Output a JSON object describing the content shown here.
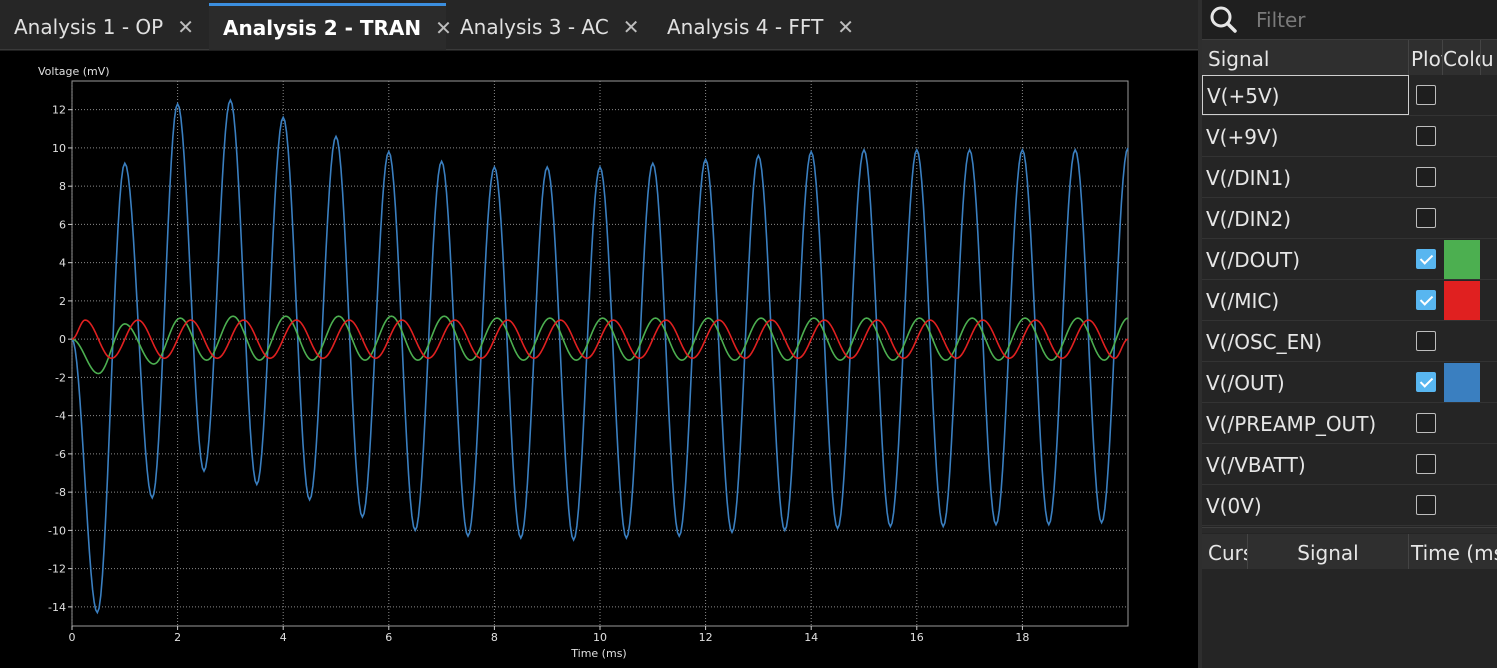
{
  "tabs": [
    {
      "label": "Analysis 1 - OP",
      "active": false
    },
    {
      "label": "Analysis 2 - TRAN",
      "active": true
    },
    {
      "label": "Analysis 3 - AC",
      "active": false
    },
    {
      "label": "Analysis 4 - FFT",
      "active": false
    }
  ],
  "search": {
    "placeholder": "Filter",
    "icon": "search-icon"
  },
  "signals_table": {
    "headers": {
      "signal": "Signal",
      "plot": "Plot",
      "color": "Color",
      "unit": "u"
    },
    "rows": [
      {
        "name": "V(+5V)",
        "plotted": false,
        "color": null,
        "selected": true
      },
      {
        "name": "V(+9V)",
        "plotted": false,
        "color": null
      },
      {
        "name": "V(/DIN1)",
        "plotted": false,
        "color": null
      },
      {
        "name": "V(/DIN2)",
        "plotted": false,
        "color": null
      },
      {
        "name": "V(/DOUT)",
        "plotted": true,
        "color": "#4caf50"
      },
      {
        "name": "V(/MIC)",
        "plotted": true,
        "color": "#e02020"
      },
      {
        "name": "V(/OSC_EN)",
        "plotted": false,
        "color": null
      },
      {
        "name": "V(/OUT)",
        "plotted": true,
        "color": "#3a7fc0"
      },
      {
        "name": "V(/PREAMP_OUT)",
        "plotted": false,
        "color": null
      },
      {
        "name": "V(/VBATT)",
        "plotted": false,
        "color": null
      },
      {
        "name": "V(0V)",
        "plotted": false,
        "color": null
      }
    ]
  },
  "cursors_table": {
    "headers": {
      "cursor": "Cursor",
      "signal": "Signal",
      "time": "Time (ms)"
    }
  },
  "chart_data": {
    "type": "line",
    "ylabel": "Voltage (mV)",
    "xlabel": "Time (ms)",
    "xlim": [
      0,
      20
    ],
    "ylim": [
      -15,
      13.5
    ],
    "xticks": [
      0,
      2,
      4,
      6,
      8,
      10,
      12,
      14,
      16,
      18
    ],
    "yticks": [
      12,
      10,
      8,
      6,
      4,
      2,
      0,
      -2,
      -4,
      -6,
      -8,
      -10,
      -12,
      -14
    ],
    "grid": true,
    "series": [
      {
        "name": "V(/OUT)",
        "color": "#3a7fc0",
        "x": [
          0,
          0.48,
          1.0,
          1.52,
          2.0,
          2.5,
          3.0,
          3.5,
          4.0,
          4.5,
          5.0,
          5.5,
          6.0,
          6.5,
          7.0,
          7.5,
          8.0,
          8.5,
          9.0,
          9.5,
          10.0,
          10.5,
          11.0,
          11.5,
          12.0,
          12.5,
          13.0,
          13.5,
          14.0,
          14.5,
          15.0,
          15.5,
          16.0,
          16.5,
          17.0,
          17.5,
          18.0,
          18.5,
          19.0,
          19.5,
          20.0
        ],
        "y": [
          0,
          -14.3,
          9.2,
          -8.3,
          12.3,
          -6.9,
          12.5,
          -7.6,
          11.6,
          -8.4,
          10.6,
          -9.3,
          9.8,
          -10.0,
          9.3,
          -10.3,
          9.0,
          -10.4,
          9.0,
          -10.5,
          9.0,
          -10.4,
          9.2,
          -10.3,
          9.4,
          -10.1,
          9.6,
          -10.0,
          9.8,
          -9.9,
          9.9,
          -9.8,
          9.9,
          -9.8,
          9.9,
          -9.7,
          9.9,
          -9.7,
          9.9,
          -9.6,
          10.0
        ]
      },
      {
        "name": "V(/DOUT)",
        "color": "#4caf50",
        "x": [
          0,
          0.5,
          1.0,
          1.55,
          2.05,
          2.55,
          3.05,
          3.55,
          4.05,
          4.55,
          5.05,
          5.55,
          6.05,
          6.55,
          7.05,
          7.55,
          8.05,
          8.55,
          9.05,
          9.55,
          10.05,
          10.55,
          11.05,
          11.55,
          12.05,
          12.55,
          13.05,
          13.55,
          14.05,
          14.55,
          15.05,
          15.55,
          16.05,
          16.55,
          17.05,
          17.55,
          18.05,
          18.55,
          19.05,
          19.55,
          20.0
        ],
        "y": [
          0,
          -1.8,
          0.8,
          -1.3,
          1.1,
          -1.1,
          1.2,
          -1.1,
          1.2,
          -1.1,
          1.2,
          -1.1,
          1.2,
          -1.1,
          1.2,
          -1.1,
          1.1,
          -1.1,
          1.1,
          -1.1,
          1.1,
          -1.1,
          1.1,
          -1.1,
          1.1,
          -1.1,
          1.1,
          -1.1,
          1.1,
          -1.1,
          1.1,
          -1.1,
          1.1,
          -1.1,
          1.1,
          -1.1,
          1.1,
          -1.1,
          1.1,
          -1.1,
          1.1
        ]
      },
      {
        "name": "V(/MIC)",
        "color": "#e02020",
        "x": [
          0,
          0.25,
          0.75,
          1.25,
          1.75,
          2.25,
          2.75,
          3.25,
          3.75,
          4.25,
          4.75,
          5.25,
          5.75,
          6.25,
          6.75,
          7.25,
          7.75,
          8.25,
          8.75,
          9.25,
          9.75,
          10.25,
          10.75,
          11.25,
          11.75,
          12.25,
          12.75,
          13.25,
          13.75,
          14.25,
          14.75,
          15.25,
          15.75,
          16.25,
          16.75,
          17.25,
          17.75,
          18.25,
          18.75,
          19.25,
          19.75,
          20.0
        ],
        "y": [
          0,
          1.0,
          -1.0,
          1.0,
          -1.0,
          1.0,
          -1.0,
          1.0,
          -1.0,
          1.0,
          -1.0,
          1.0,
          -1.0,
          1.0,
          -1.0,
          1.0,
          -1.0,
          1.0,
          -1.0,
          1.0,
          -1.0,
          1.0,
          -1.0,
          1.0,
          -1.0,
          1.0,
          -1.0,
          1.0,
          -1.0,
          1.0,
          -1.0,
          1.0,
          -1.0,
          1.0,
          -1.0,
          1.0,
          -1.0,
          1.0,
          -1.0,
          1.0,
          -1.0,
          0
        ]
      }
    ]
  }
}
